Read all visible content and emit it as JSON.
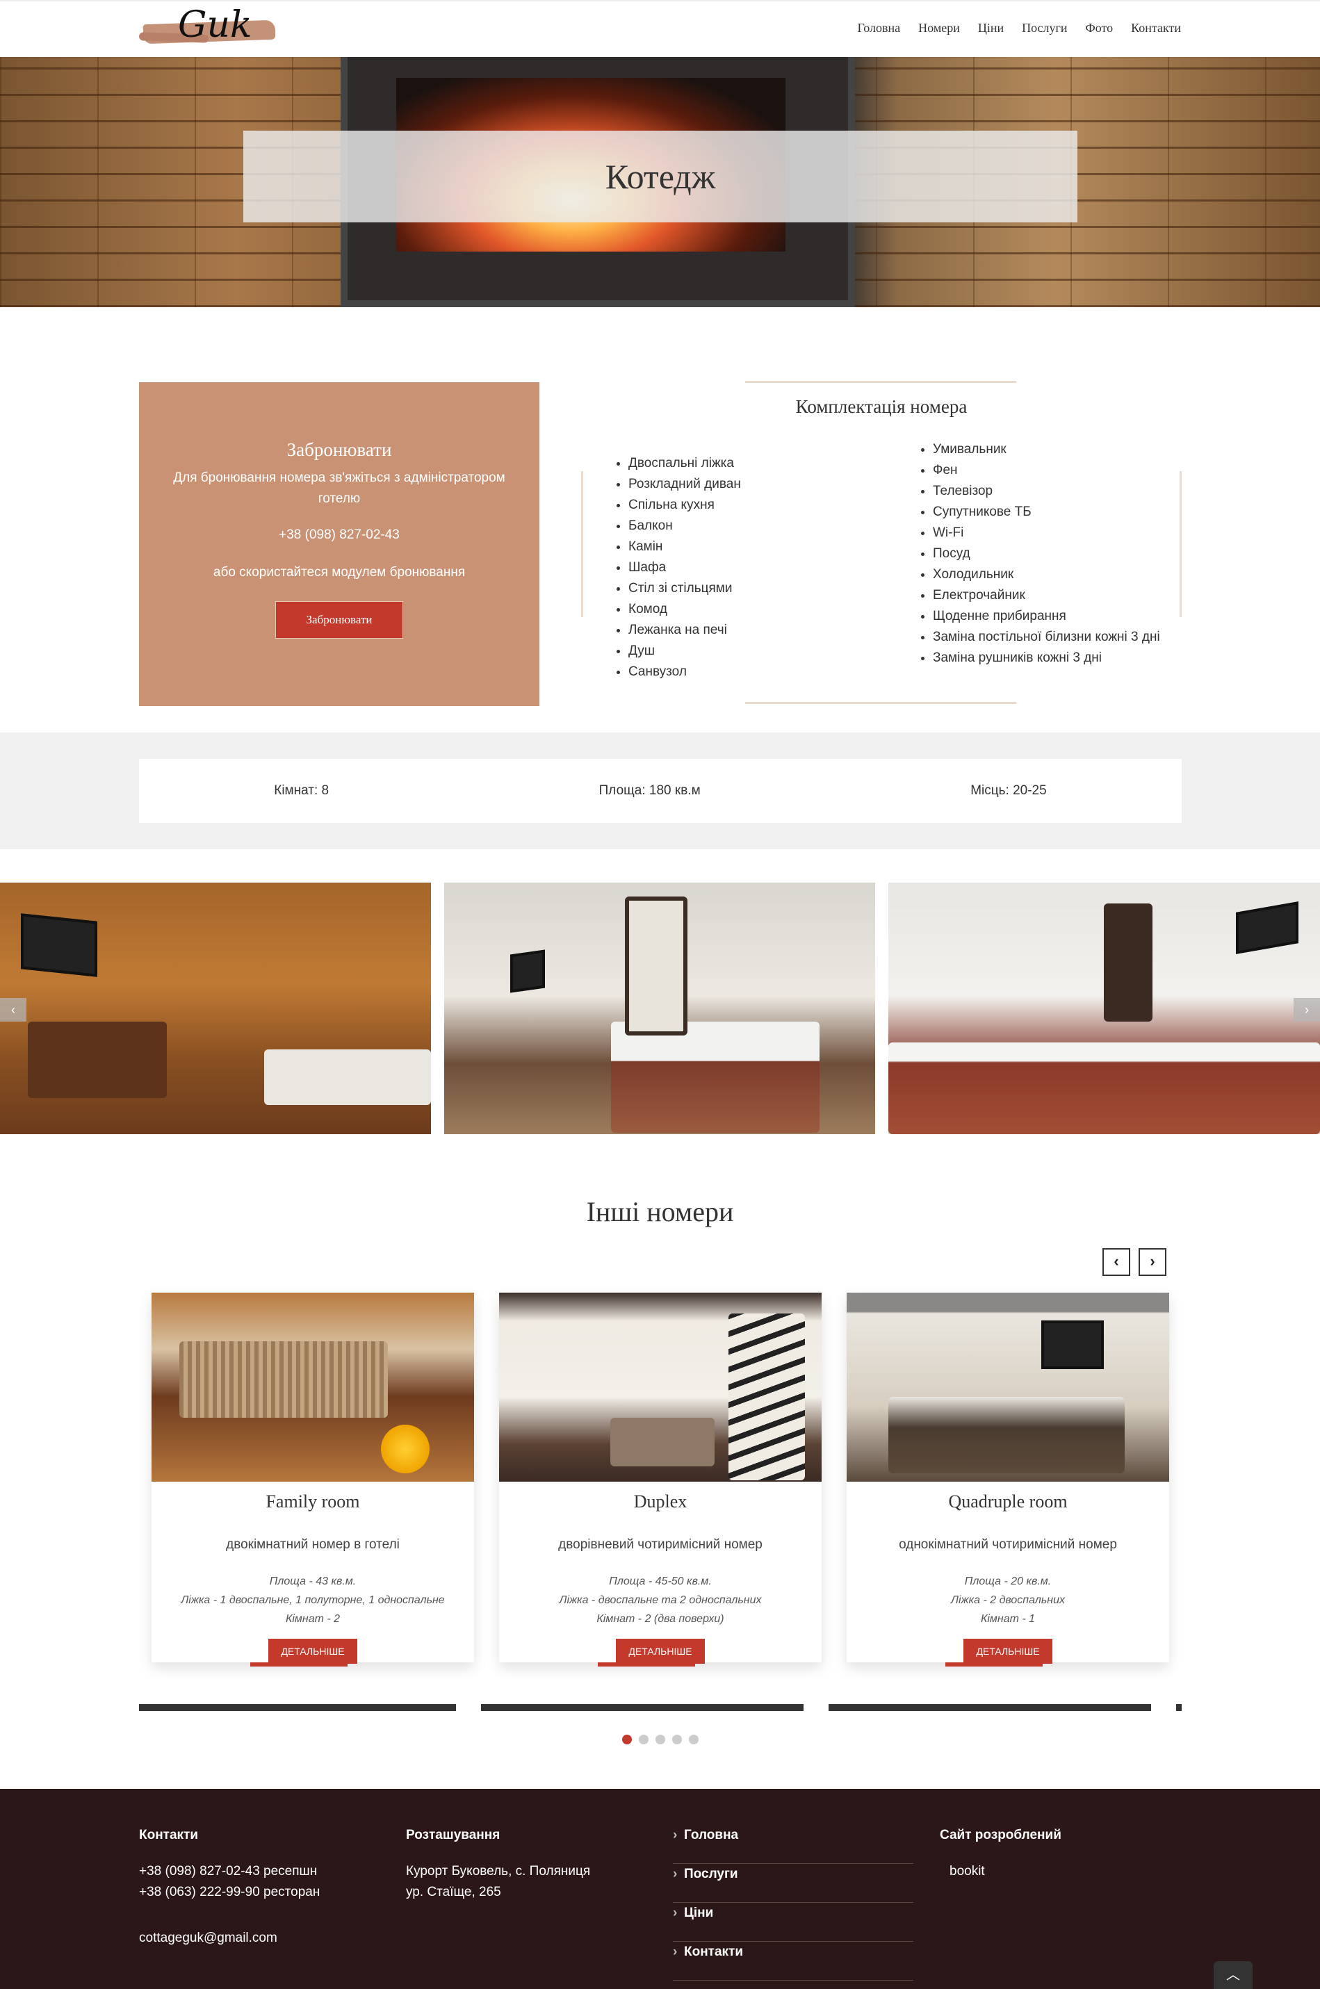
{
  "header": {
    "logo_text": "Guk",
    "nav": [
      "Головна",
      "Номери",
      "Ціни",
      "Послуги",
      "Фото",
      "Контакти"
    ]
  },
  "hero": {
    "title": "Котедж"
  },
  "booking": {
    "title": "Забронювати",
    "text": "Для бронювання номера зв'яжіться з адміністратором готелю",
    "phone": "+38 (098) 827-02-43",
    "or_text": "або скористайтеся модулем бронювання",
    "button": "Забронювати"
  },
  "amenities": {
    "title": "Комплектація номера",
    "col1": [
      "Двоспальні ліжка",
      "Розкладний диван",
      "Спільна кухня",
      "Балкон",
      "Камін",
      "Шафа",
      "Стіл зі стільцями",
      "Комод",
      "Лежанка на печі",
      "Душ",
      "Санвузол"
    ],
    "col2": [
      "Умивальник",
      "Фен",
      "Телевізор",
      "Супутникове ТБ",
      "Wi-Fi",
      "Посуд",
      "Холодильник",
      "Електрочайник",
      "Щоденне прибирання",
      "Заміна постільної білизни кожні 3 дні",
      "Заміна рушників кожні 3 дні"
    ]
  },
  "stats": {
    "rooms": "Кімнат: 8",
    "area": "Площа: 180 кв.м",
    "places": "Місць: 20-25"
  },
  "gallery": {
    "prev": "‹",
    "next": "›"
  },
  "others": {
    "title": "Інші номери",
    "prev": "‹",
    "next": "›",
    "cards": [
      {
        "name": "Family room",
        "desc": "двокімнатний номер в готелі",
        "area": "Площа - 43 кв.м.",
        "beds": "Ліжка - 1 двоспальне, 1 полуторне, 1 односпальне",
        "rooms": "Кімнат - 2",
        "button": "Детальніше"
      },
      {
        "name": "Duplex",
        "desc": "дворівневий чотиримісний номер",
        "area": "Площа - 45-50 кв.м.",
        "beds": "Ліжка - двоспальне та 2 односпальних",
        "rooms": "Кімнат - 2 (два поверхи)",
        "button": "Детальніше"
      },
      {
        "name": "Quadruple room",
        "desc": "однокімнатний чотиримісний номер",
        "area": "Площа - 20 кв.м.",
        "beds": "Ліжка - 2 двоспальних",
        "rooms": "Кімнат - 1",
        "button": "Детальніше"
      }
    ]
  },
  "footer": {
    "contacts_title": "Контакти",
    "phone1": "+38 (098) 827-02-43 ресепшн",
    "phone2": "+38 (063) 222-99-90 ресторан",
    "email": "cottageguk@gmail.com",
    "location_title": "Розташування",
    "address1": "Курорт Буковель, с. Поляниця",
    "address2": "ур. Стаїще, 265",
    "links": [
      "Головна",
      "Послуги",
      "Ціни",
      "Контакти"
    ],
    "dev_title": "Сайт розроблений",
    "dev_logo_alt": "bookit",
    "to_top": "︿"
  }
}
